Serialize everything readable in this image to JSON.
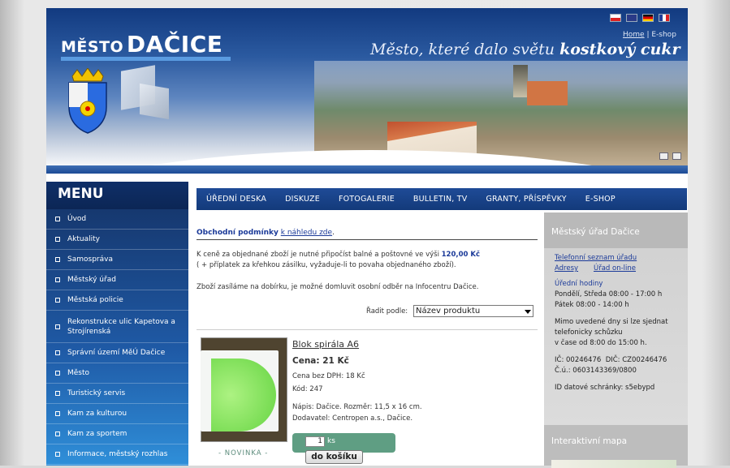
{
  "header": {
    "logo_small": "MĚSTO",
    "logo_big": "DAČICE",
    "slogan_pre": "Město, které dalo světu",
    "slogan_bold": "kostkový cukr",
    "top_links": [
      "Home",
      "E-shop"
    ],
    "flags": [
      "cz-flag-icon",
      "uk-flag-icon",
      "de-flag-icon",
      "fr-flag-icon"
    ]
  },
  "menu": {
    "title": "MENU",
    "items": [
      "Úvod",
      "Aktuality",
      "Samospráva",
      "Městský úřad",
      "Městská policie",
      "Rekonstrukce ulic Kapetova a Strojírenská",
      "Správní území MěÚ Dačice",
      "Město",
      "Turistický servis",
      "Kam za kulturou",
      "Kam za sportem",
      "Informace, městský rozhlas"
    ]
  },
  "nav": [
    "ÚŘEDNÍ DESKA",
    "DISKUZE",
    "FOTOGALERIE",
    "BULLETIN, TV",
    "GRANTY, PŘÍSPĚVKY",
    "E-SHOP"
  ],
  "center": {
    "terms_label": "Obchodní podmínky",
    "terms_link": "k náhledu zde",
    "terms_dot": ".",
    "info1_pre": "K ceně za objednané zboží je nutné připočíst balné a poštovné ve výši",
    "info1_price": "120,00 Kč",
    "info1_line2": "( + příplatek za křehkou zásilku, vyžaduje-li to povaha objednaného zboží).",
    "info2": "Zboží zasíláme na dobírku, je možné domluvit osobní odběr na Infocentru Dačice.",
    "sort_label": "Řadit podle:",
    "sort_value": "Název produktu",
    "product": {
      "name": "Blok spirála A6",
      "price": "Cena: 21 Kč",
      "price_novat": "Cena bez DPH: 18 Kč",
      "code": "Kód: 247",
      "desc": "Nápis: Dačice. Rozměr: 11,5 x 16 cm.",
      "supplier": "Dodavatel: Centropen a.s., Dačice.",
      "badge": "- NOVINKA -",
      "qty": "1",
      "unit": "ks",
      "cart_button": "do košíku"
    }
  },
  "right": {
    "title": "Městský úřad Dačice",
    "link_phone": "Telefonní seznam úřadu",
    "link_addr": "Adresy",
    "link_online": "Úřad on-line",
    "hours_title": "Úřední hodiny",
    "hours1": "Pondělí, Středa 08:00 - 17:00 h",
    "hours2": "Pátek 08:00 - 14:00 h",
    "extra1": "Mimo uvedené dny si lze sjednat",
    "extra2": "telefonicky schůzku",
    "extra3": "v čase od 8:00 do 15:00 h.",
    "ic": "IČ: 00246476",
    "dic": "DIČ: CZ00246476",
    "cu": "Č.ú.: 0603143369/0800",
    "ds": "ID datové schránky: s5ebypd",
    "map_title": "Interaktivní mapa"
  }
}
